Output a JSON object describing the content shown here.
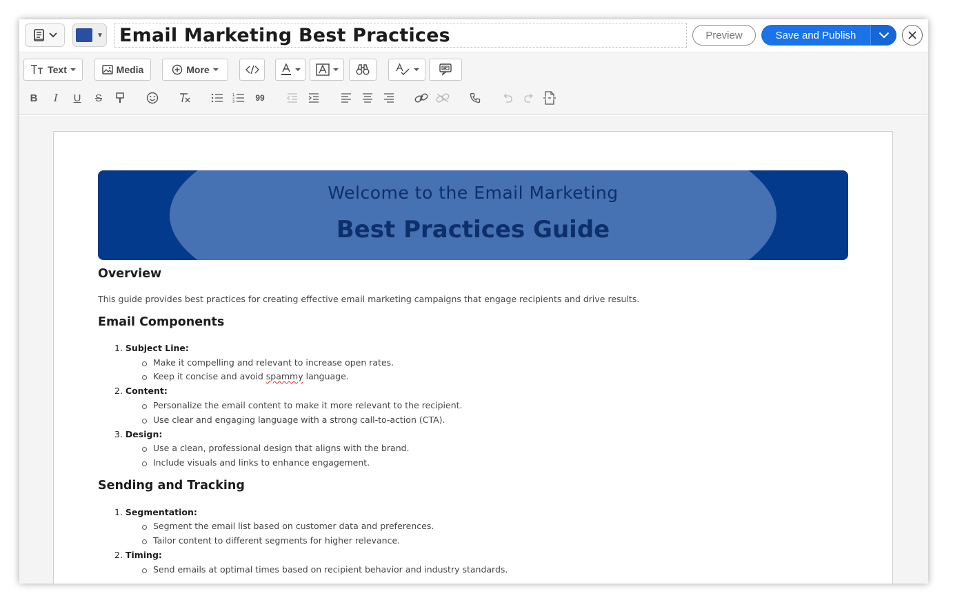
{
  "header": {
    "title": "Email Marketing Best Practices",
    "preview_label": "Preview",
    "publish_label": "Save and Publish",
    "accent_color": "#1a73e8",
    "doc_color": "#2a4ea0"
  },
  "toolbar": {
    "text_label": "Text",
    "media_label": "Media",
    "more_label": "More",
    "quote_label": "99"
  },
  "banner": {
    "line1": "Welcome to the Email Marketing",
    "line2": "Best Practices Guide",
    "bg_color": "#033a8b",
    "ellipse_color": "#4671b2"
  },
  "document": {
    "overview_heading": "Overview",
    "overview_text": "This guide provides best practices for creating effective email marketing campaigns that engage recipients and drive results.",
    "components_heading": "Email Components",
    "components": [
      {
        "num": "1.",
        "label": "Subject Line:",
        "bullets": [
          "Make it compelling and relevant to increase open rates.",
          "Keep it concise and avoid ",
          "spammy",
          " language."
        ]
      },
      {
        "num": "2.",
        "label": "Content:",
        "bullets": [
          "Personalize the email content to make it more relevant to the recipient.",
          "Use clear and engaging language with a strong call-to-action (CTA)."
        ]
      },
      {
        "num": "3.",
        "label": "Design:",
        "bullets": [
          "Use a clean, professional design that aligns with the brand.",
          "Include visuals and links to enhance engagement."
        ]
      }
    ],
    "sending_heading": "Sending and Tracking",
    "sending": [
      {
        "num": "1.",
        "label": "Segmentation:",
        "bullets": [
          "Segment the email list based on customer data and preferences.",
          "Tailor content to different segments for higher relevance."
        ]
      },
      {
        "num": "2.",
        "label": "Timing:",
        "bullets": [
          "Send emails at optimal times based on recipient behavior and industry standards."
        ]
      }
    ]
  }
}
